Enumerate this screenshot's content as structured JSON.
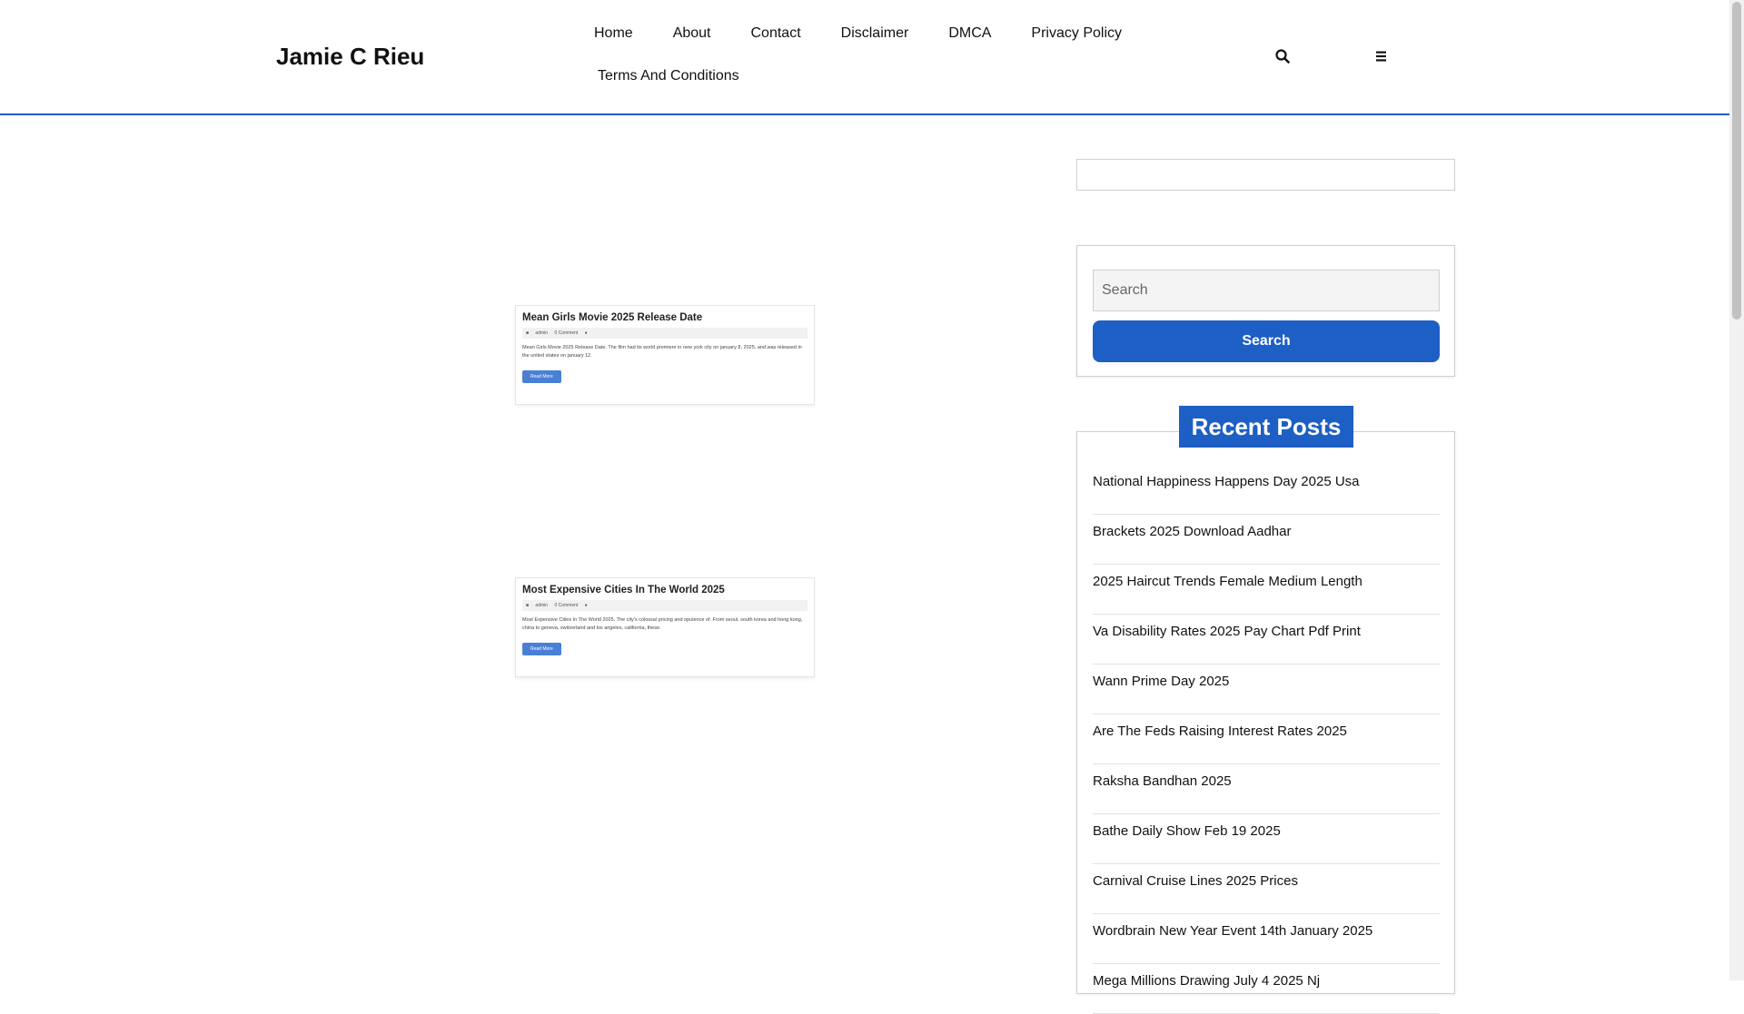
{
  "header": {
    "site_title": "Jamie C Rieu",
    "nav": [
      "Home",
      "About",
      "Contact",
      "Disclaimer",
      "DMCA",
      "Privacy Policy",
      "Terms And Conditions"
    ],
    "icons": {
      "search": "search-icon",
      "menu": "menu-icon"
    }
  },
  "posts": [
    {
      "title": "Mean Girls Movie 2025 Release Date",
      "meta": {
        "author": "admin",
        "comments": "0 Comment"
      },
      "excerpt": "Mean Girls Movie 2025 Release Date. The film had its world premiere in new york city on january 8, 2025, and was released in the united states on january 12.",
      "read_more": "Read More"
    },
    {
      "title": "Most Expensive Cities In The World 2025",
      "meta": {
        "author": "admin",
        "comments": "0 Comment"
      },
      "excerpt": "Most Expensive Cities In The World 2025. The city's colossal pricing and opulence of. From seoul, south korea and hong kong, china to geneva, switzerland and los angeles, california, these.",
      "read_more": "Read More"
    }
  ],
  "sidebar": {
    "search": {
      "placeholder": "Search",
      "button_label": "Search"
    },
    "recent_posts": {
      "heading": "Recent Posts",
      "items": [
        "National Happiness Happens Day 2025 Usa",
        "Brackets 2025 Download Aadhar",
        "2025 Haircut Trends Female Medium Length",
        "Va Disability Rates 2025 Pay Chart Pdf Print",
        "Wann Prime Day 2025",
        "Are The Feds Raising Interest Rates 2025",
        "Raksha Bandhan 2025",
        "Bathe Daily Show Feb 19 2025",
        "Carnival Cruise Lines 2025 Prices",
        "Wordbrain New Year Event 14th January 2025",
        "Mega Millions Drawing July 4 2025 Nj"
      ]
    }
  },
  "colors": {
    "accent": "#1d5fc4",
    "border": "#cfcfcf"
  }
}
